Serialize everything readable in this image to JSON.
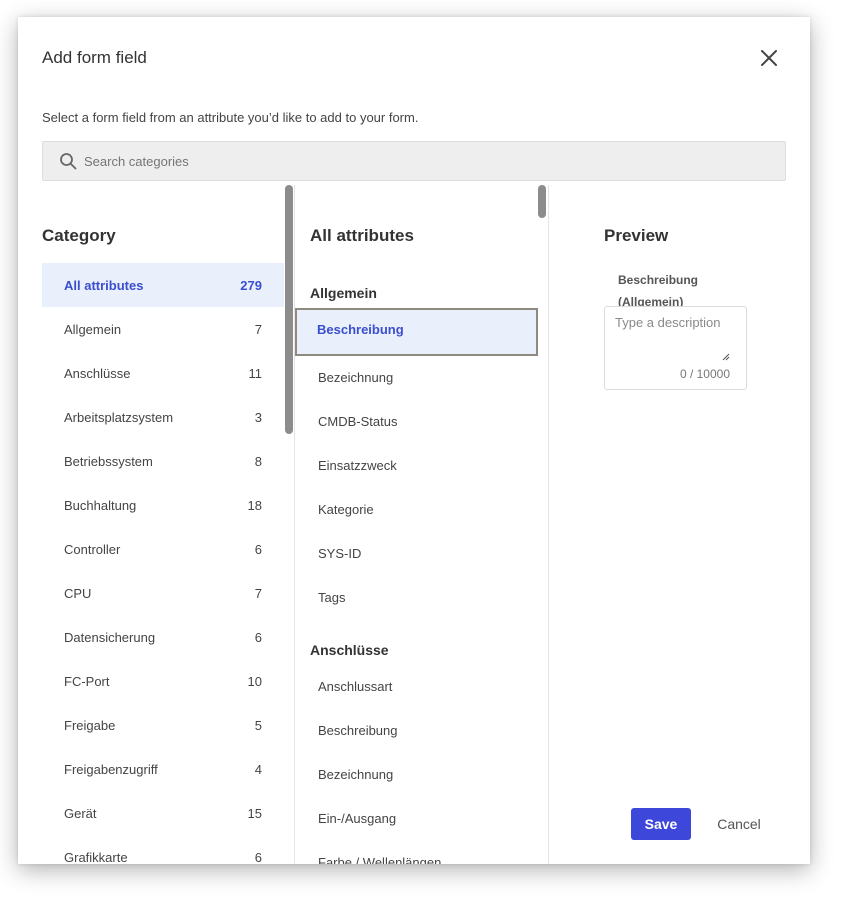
{
  "modal": {
    "title": "Add form field",
    "subtitle": "Select a form field from an attribute you’d like to add to your form.",
    "close_icon": "close-icon"
  },
  "search": {
    "placeholder": "Search categories",
    "icon": "search-icon"
  },
  "categories": {
    "heading": "Category",
    "items": [
      {
        "label": "All attributes",
        "count": "279",
        "active": true
      },
      {
        "label": "Allgemein",
        "count": "7"
      },
      {
        "label": "Anschlüsse",
        "count": "11"
      },
      {
        "label": "Arbeitsplatzsystem",
        "count": "3"
      },
      {
        "label": "Betriebssystem",
        "count": "8"
      },
      {
        "label": "Buchhaltung",
        "count": "18"
      },
      {
        "label": "Controller",
        "count": "6"
      },
      {
        "label": "CPU",
        "count": "7"
      },
      {
        "label": "Datensicherung",
        "count": "6"
      },
      {
        "label": "FC-Port",
        "count": "10"
      },
      {
        "label": "Freigabe",
        "count": "5"
      },
      {
        "label": "Freigabenzugriff",
        "count": "4"
      },
      {
        "label": "Gerät",
        "count": "15"
      },
      {
        "label": "Grafikkarte",
        "count": "6"
      }
    ]
  },
  "attributes": {
    "heading": "All attributes",
    "groups": [
      {
        "name": "Allgemein",
        "items": [
          "Beschreibung",
          "Bezeichnung",
          "CMDB-Status",
          "Einsatzzweck",
          "Kategorie",
          "SYS-ID",
          "Tags"
        ]
      },
      {
        "name": "Anschlüsse",
        "items": [
          "Anschlussart",
          "Beschreibung",
          "Bezeichnung",
          "Ein-/Ausgang",
          "Farbe / Wellenlängen"
        ]
      }
    ],
    "selected": "Beschreibung (Allgemein)"
  },
  "preview": {
    "heading": "Preview",
    "field_label": "Beschreibung (Allgemein)",
    "placeholder": "Type a description",
    "char_count": "0 / 10000"
  },
  "actions": {
    "save_label": "Save",
    "cancel_label": "Cancel"
  },
  "colors": {
    "accent": "#3d47d9",
    "selected_bg": "#e9f0fc",
    "selected_text": "#3b4ed0",
    "selected_border": "#8f8a7f",
    "search_bg": "#eeeeee"
  }
}
